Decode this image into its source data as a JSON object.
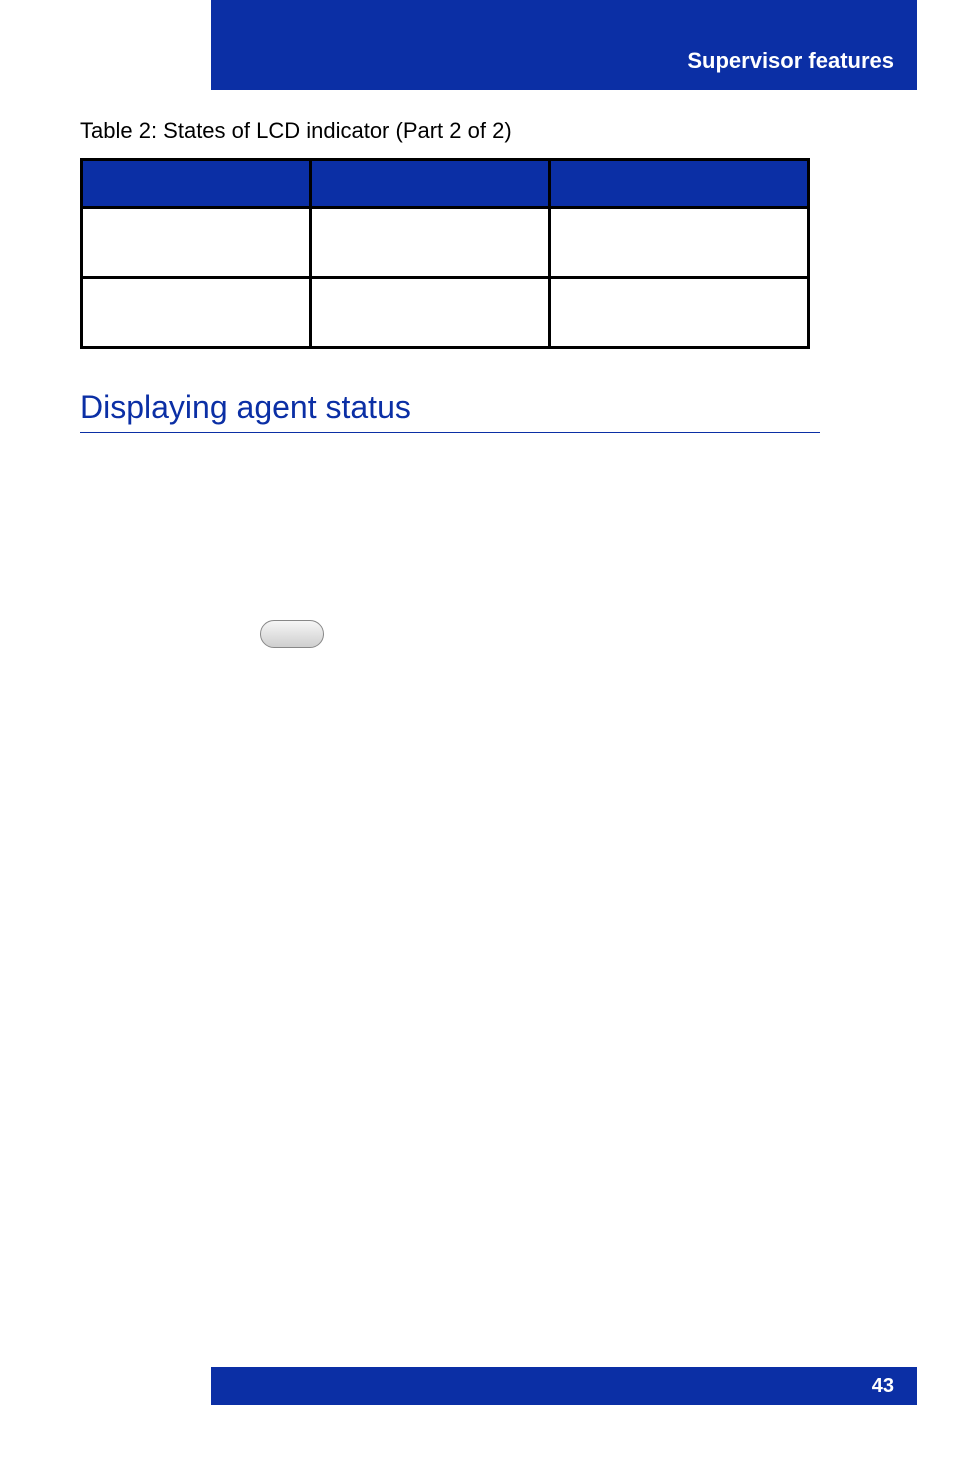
{
  "header": {
    "title": "Supervisor features"
  },
  "table": {
    "caption": "Table 2: States of LCD indicator (Part 2 of 2)",
    "columns": [
      "",
      "",
      ""
    ],
    "rows": [
      [
        "",
        "",
        ""
      ],
      [
        "",
        "",
        ""
      ]
    ]
  },
  "section": {
    "heading": "Displaying agent status"
  },
  "footer": {
    "page_number": "43"
  }
}
